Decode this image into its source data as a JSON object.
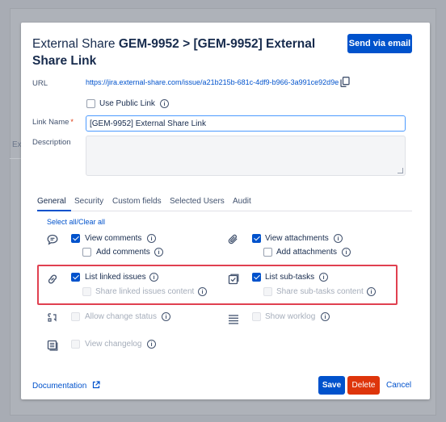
{
  "background": {
    "partial_label": "Ex"
  },
  "dialog": {
    "title_prefix": "External Share",
    "title_bold": "GEM-9952 > [GEM-9952] External Share Link",
    "send_email_label": "Send via email"
  },
  "form": {
    "url_label": "URL",
    "url_value": "https://jira.external-share.com/issue/a21b215b-681c-4df9-b966-3a991ce92d9e",
    "use_public_link_label": "Use Public Link",
    "link_name_label": "Link Name",
    "link_name_required": "*",
    "link_name_value": "[GEM-9952] External Share Link",
    "description_label": "Description"
  },
  "tabs": [
    "General",
    "Security",
    "Custom fields",
    "Selected Users",
    "Audit"
  ],
  "active_tab": "General",
  "select_all": "Select all",
  "clear_all": "Clear all",
  "select_separator": "/",
  "permissions": {
    "view_comments": "View comments",
    "add_comments": "Add comments",
    "view_attachments": "View attachments",
    "add_attachments": "Add attachments",
    "list_linked_issues": "List linked issues",
    "share_linked_issues_content": "Share linked issues content",
    "list_sub_tasks": "List sub-tasks",
    "share_sub_tasks_content": "Share sub-tasks content",
    "allow_change_status": "Allow change status",
    "show_worklog": "Show worklog",
    "view_changelog": "View changelog"
  },
  "footer": {
    "documentation": "Documentation",
    "save": "Save",
    "delete": "Delete",
    "cancel": "Cancel"
  },
  "colors": {
    "primary": "#0052cc",
    "danger": "#de350b",
    "highlight": "#e04050"
  },
  "icons": [
    "copy-icon",
    "info-icon",
    "comment-icon",
    "paperclip-icon",
    "link-icon",
    "subtask-icon",
    "status-icon",
    "worklog-icon",
    "changelog-icon",
    "external-link-icon"
  ]
}
